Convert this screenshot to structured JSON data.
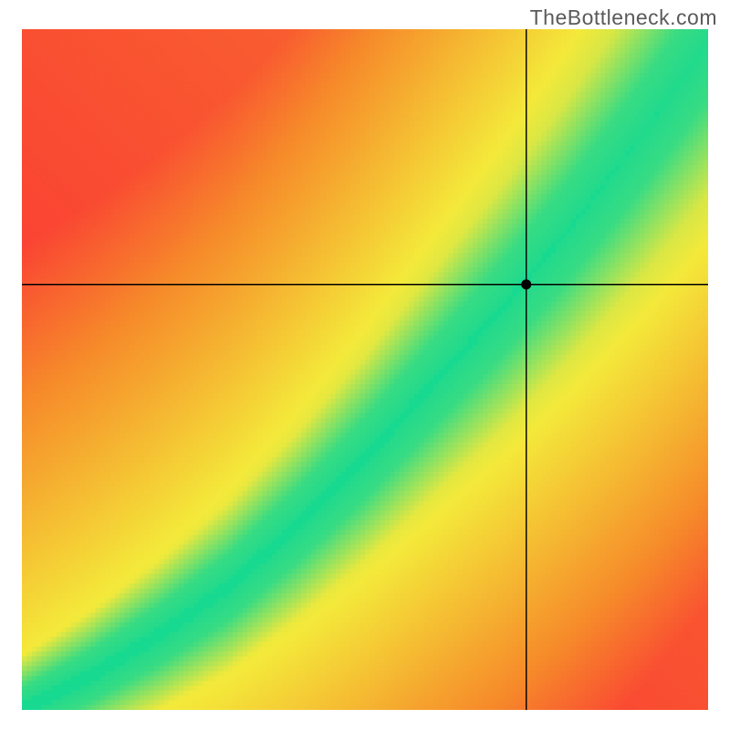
{
  "attribution": "TheBottleneck.com",
  "chart_data": {
    "type": "heatmap",
    "title": "",
    "xlabel": "",
    "ylabel": "",
    "xlim": [
      0,
      100
    ],
    "ylim": [
      0,
      100
    ],
    "crosshair": {
      "x": 73.5,
      "y": 62.5
    },
    "marker": {
      "x": 73.5,
      "y": 62.5
    },
    "green_ridge_center": [
      {
        "x": 0,
        "y": 0
      },
      {
        "x": 10,
        "y": 5
      },
      {
        "x": 20,
        "y": 11
      },
      {
        "x": 30,
        "y": 18
      },
      {
        "x": 40,
        "y": 27
      },
      {
        "x": 50,
        "y": 37
      },
      {
        "x": 60,
        "y": 48
      },
      {
        "x": 70,
        "y": 59
      },
      {
        "x": 80,
        "y": 71
      },
      {
        "x": 90,
        "y": 84
      },
      {
        "x": 100,
        "y": 98
      }
    ],
    "green_ridge_width_fraction": 0.055,
    "yellow_envelope_width_fraction": 0.16,
    "colors": {
      "green": "#18d990",
      "yellow": "#f4e93a",
      "orange": "#f68a2a",
      "red": "#fb2c36",
      "marker": "#000000",
      "crosshair": "#000000"
    },
    "legend": []
  }
}
